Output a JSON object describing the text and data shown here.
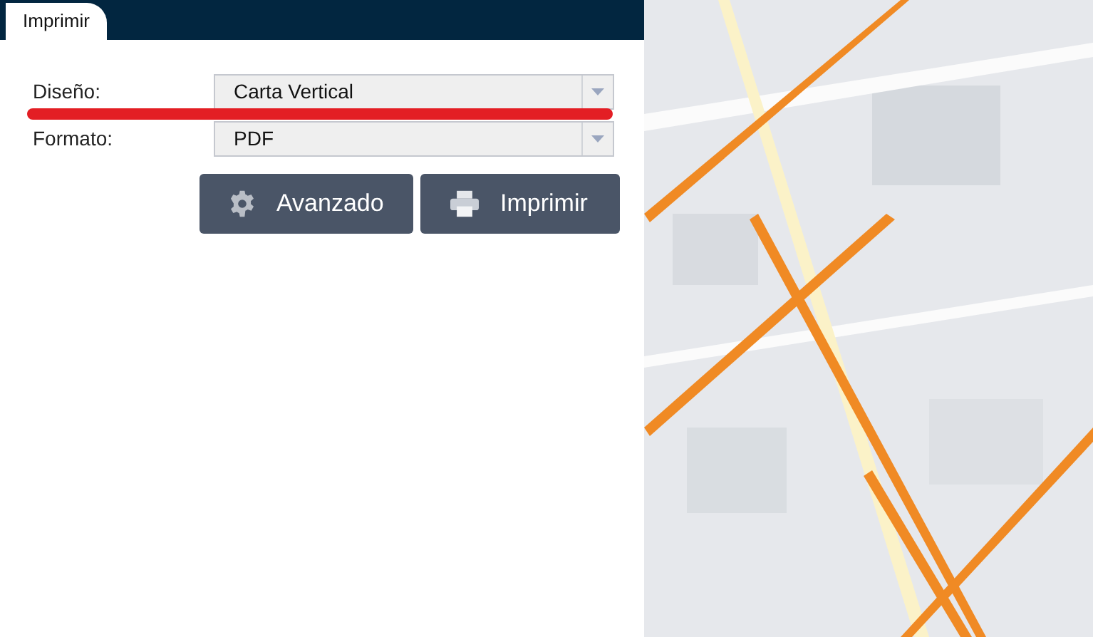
{
  "tabs": [
    {
      "label": "Imprimir",
      "selected": true
    }
  ],
  "fields": [
    {
      "label": "Diseño:",
      "value": "Carta Vertical"
    },
    {
      "label": "Formato:",
      "value": "PDF"
    }
  ],
  "buttons": [
    {
      "label": "Avanzado",
      "kind": "settings"
    },
    {
      "label": "Imprimir",
      "kind": "print"
    }
  ]
}
